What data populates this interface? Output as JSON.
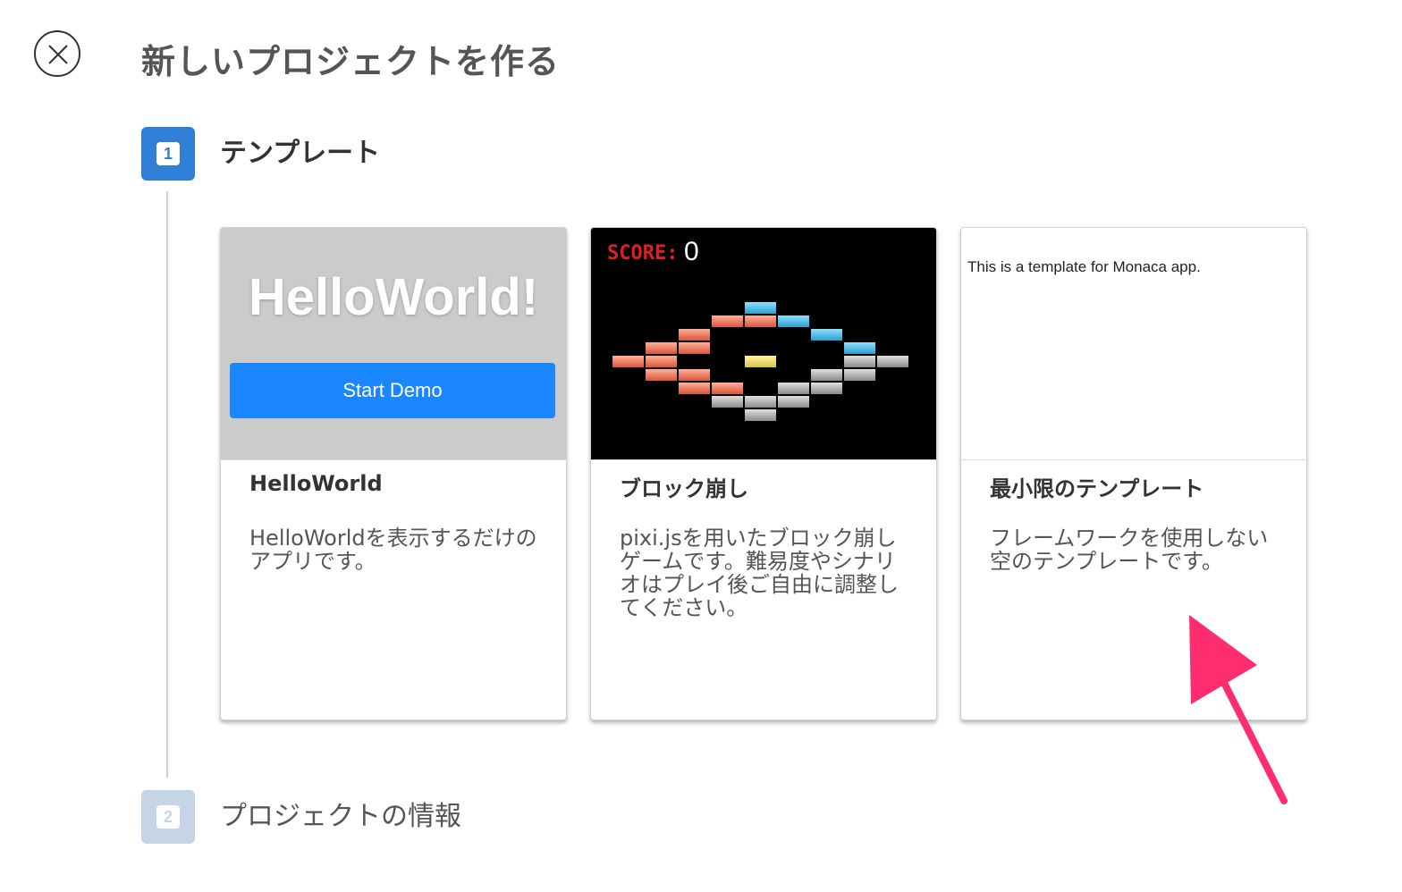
{
  "header": {
    "close_icon": "close-circle-icon",
    "title": "新しいプロジェクトを作る"
  },
  "steps": [
    {
      "number": "1",
      "label": "テンプレート",
      "state": "active",
      "color": "#2f7fd6"
    },
    {
      "number": "2",
      "label": "プロジェクトの情報",
      "state": "inactive",
      "color": "#c5d5e6"
    }
  ],
  "templates": [
    {
      "title": "HelloWorld",
      "description": "HelloWorldを表示するだけのアプリです。",
      "preview": {
        "heading": "HelloWorld!",
        "button": "Start Demo",
        "button_color": "#1a87ff"
      }
    },
    {
      "title": "ブロック崩し",
      "description": "pixi.jsを用いたブロック崩しゲームです。難易度やシナリオはプレイ後ご自由に調整してください。",
      "preview": {
        "score_label": "SCORE:",
        "score_value": "0"
      }
    },
    {
      "title": "最小限のテンプレート",
      "description": "フレームワークを使用しない空のテンプレートです。",
      "preview": {
        "text": "This is a template for Monaca app."
      }
    }
  ],
  "annotation": {
    "icon": "pink-arrow-icon",
    "color": "#ff2d6f"
  }
}
